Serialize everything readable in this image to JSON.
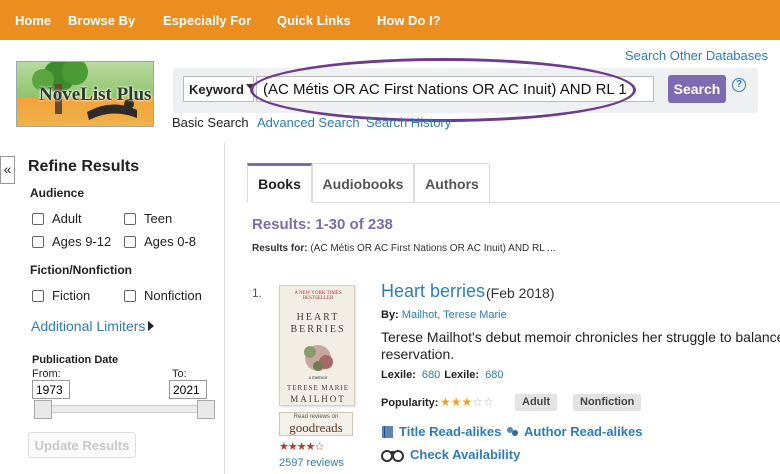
{
  "nav": {
    "items": [
      "Home",
      "Browse By",
      "Especially For",
      "Quick Links",
      "How Do I?"
    ]
  },
  "header": {
    "logo_text": "NoveList Plus",
    "other_databases": "Search Other Databases"
  },
  "search": {
    "field_select": "Keyword",
    "query": "(AC Métis OR AC First Nations OR AC Inuit) AND RL 1",
    "button_label": "Search",
    "help": "?",
    "modes": [
      "Basic Search",
      "Advanced Search",
      "Search History"
    ]
  },
  "refine": {
    "collapse_label": "«",
    "title": "Refine Results",
    "audience": {
      "heading": "Audience",
      "options": [
        "Adult",
        "Teen",
        "Ages 9-12",
        "Ages 0-8"
      ]
    },
    "fiction": {
      "heading": "Fiction/Nonfiction",
      "options": [
        "Fiction",
        "Nonfiction"
      ]
    },
    "additional_limiters": "Additional Limiters",
    "pub_date": {
      "heading": "Publication Date",
      "from_label": "From:",
      "to_label": "To:",
      "from": "1973",
      "to": "2021"
    },
    "update_button": "Update Results"
  },
  "tabs": [
    "Books",
    "Audiobooks",
    "Authors"
  ],
  "results": {
    "count_label": "Results: 1-30 of 238",
    "for_label": "Results for:",
    "for_query": "(AC Métis OR AC First Nations OR AC Inuit) AND RL ..."
  },
  "book": {
    "number": "1.",
    "cover": {
      "top_text": "A NEW YORK TIMES BESTSELLER",
      "title_line1": "HEART",
      "title_line2": "BERRIES",
      "side_text": "a memoir",
      "author_line1": "TERESE MARIE",
      "author_line2": "MAILHOT"
    },
    "goodreads_small": "Read reviews on",
    "goodreads_big": "goodreads",
    "goodreads_stars": "★★★★☆",
    "reviews": "2597 reviews",
    "title": "Heart berries",
    "date": "(Feb 2018)",
    "by_label": "By:",
    "author": "Mailhot, Terese Marie",
    "summary_line1": "Terese Mailhot's debut memoir chronicles her struggle to balance th",
    "summary_line2": "reservation.",
    "lexile_label": "Lexile:",
    "lexile_value": "680",
    "lexile_label2": "Lexile:",
    "lexile_value2": "680",
    "popularity_label": "Popularity:",
    "popularity_rating": 3,
    "popularity_max": 5,
    "badges": [
      "Adult",
      "Nonfiction"
    ],
    "title_readalikes": "Title Read-alikes",
    "author_readalikes": "Author Read-alikes",
    "check_availability": "Check Availability"
  },
  "colors": {
    "nav_bg": "#ec8d1f",
    "accent_purple": "#7d6bb1",
    "link_blue": "#2e7cc0",
    "oval": "#6e3b8e"
  }
}
